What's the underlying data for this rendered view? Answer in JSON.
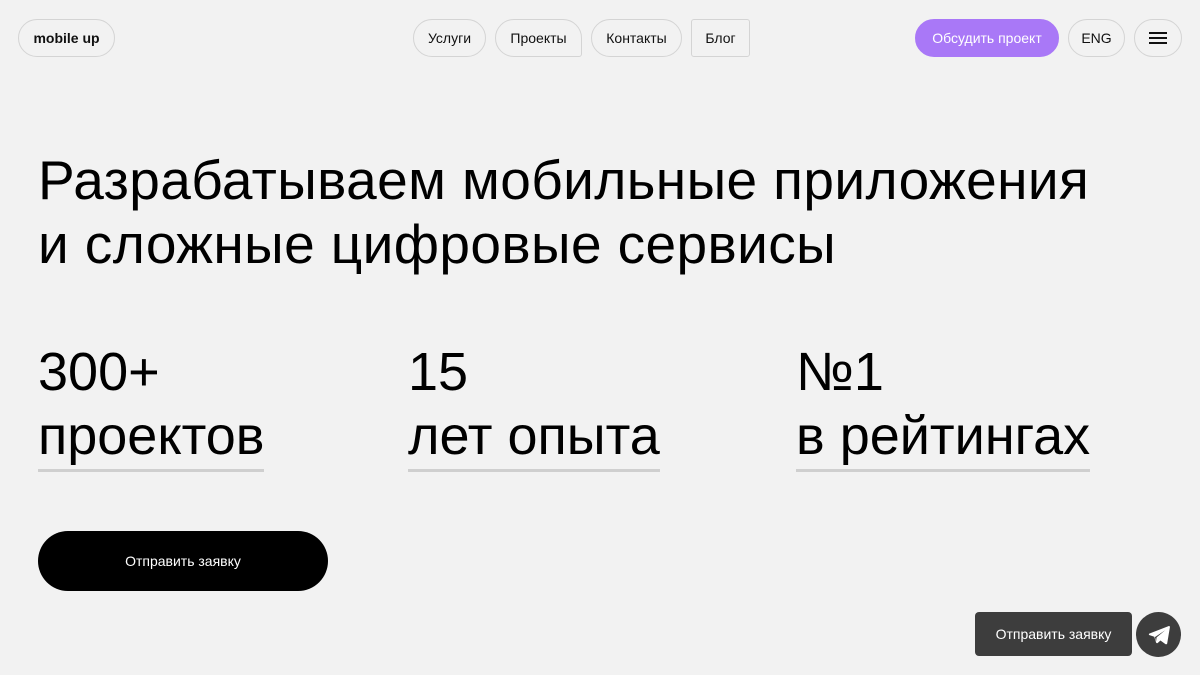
{
  "header": {
    "logo": "mobile up",
    "nav": {
      "services": "Услуги",
      "projects": "Проекты",
      "contacts": "Контакты",
      "blog": "Блог"
    },
    "cta_label": "Обсудить проект",
    "lang_label": "ENG",
    "menu_icon": "hamburger-menu-icon"
  },
  "hero": {
    "title_line1": "Разрабатываем мобильные приложения",
    "title_line2": "и сложные цифровые сервисы"
  },
  "stats": [
    {
      "value": "300+",
      "label": "проектов"
    },
    {
      "value": "15",
      "label": "лет опыта"
    },
    {
      "value": "№1",
      "label": "в рейтингах"
    }
  ],
  "main_cta": {
    "label": "Отправить заявку"
  },
  "floating": {
    "cta_label": "Отправить заявку",
    "telegram_icon": "telegram-icon"
  },
  "colors": {
    "background": "#f2f2f2",
    "accent": "#a978f7",
    "primary_button": "#000000",
    "floating_button": "#3d3d3d"
  }
}
